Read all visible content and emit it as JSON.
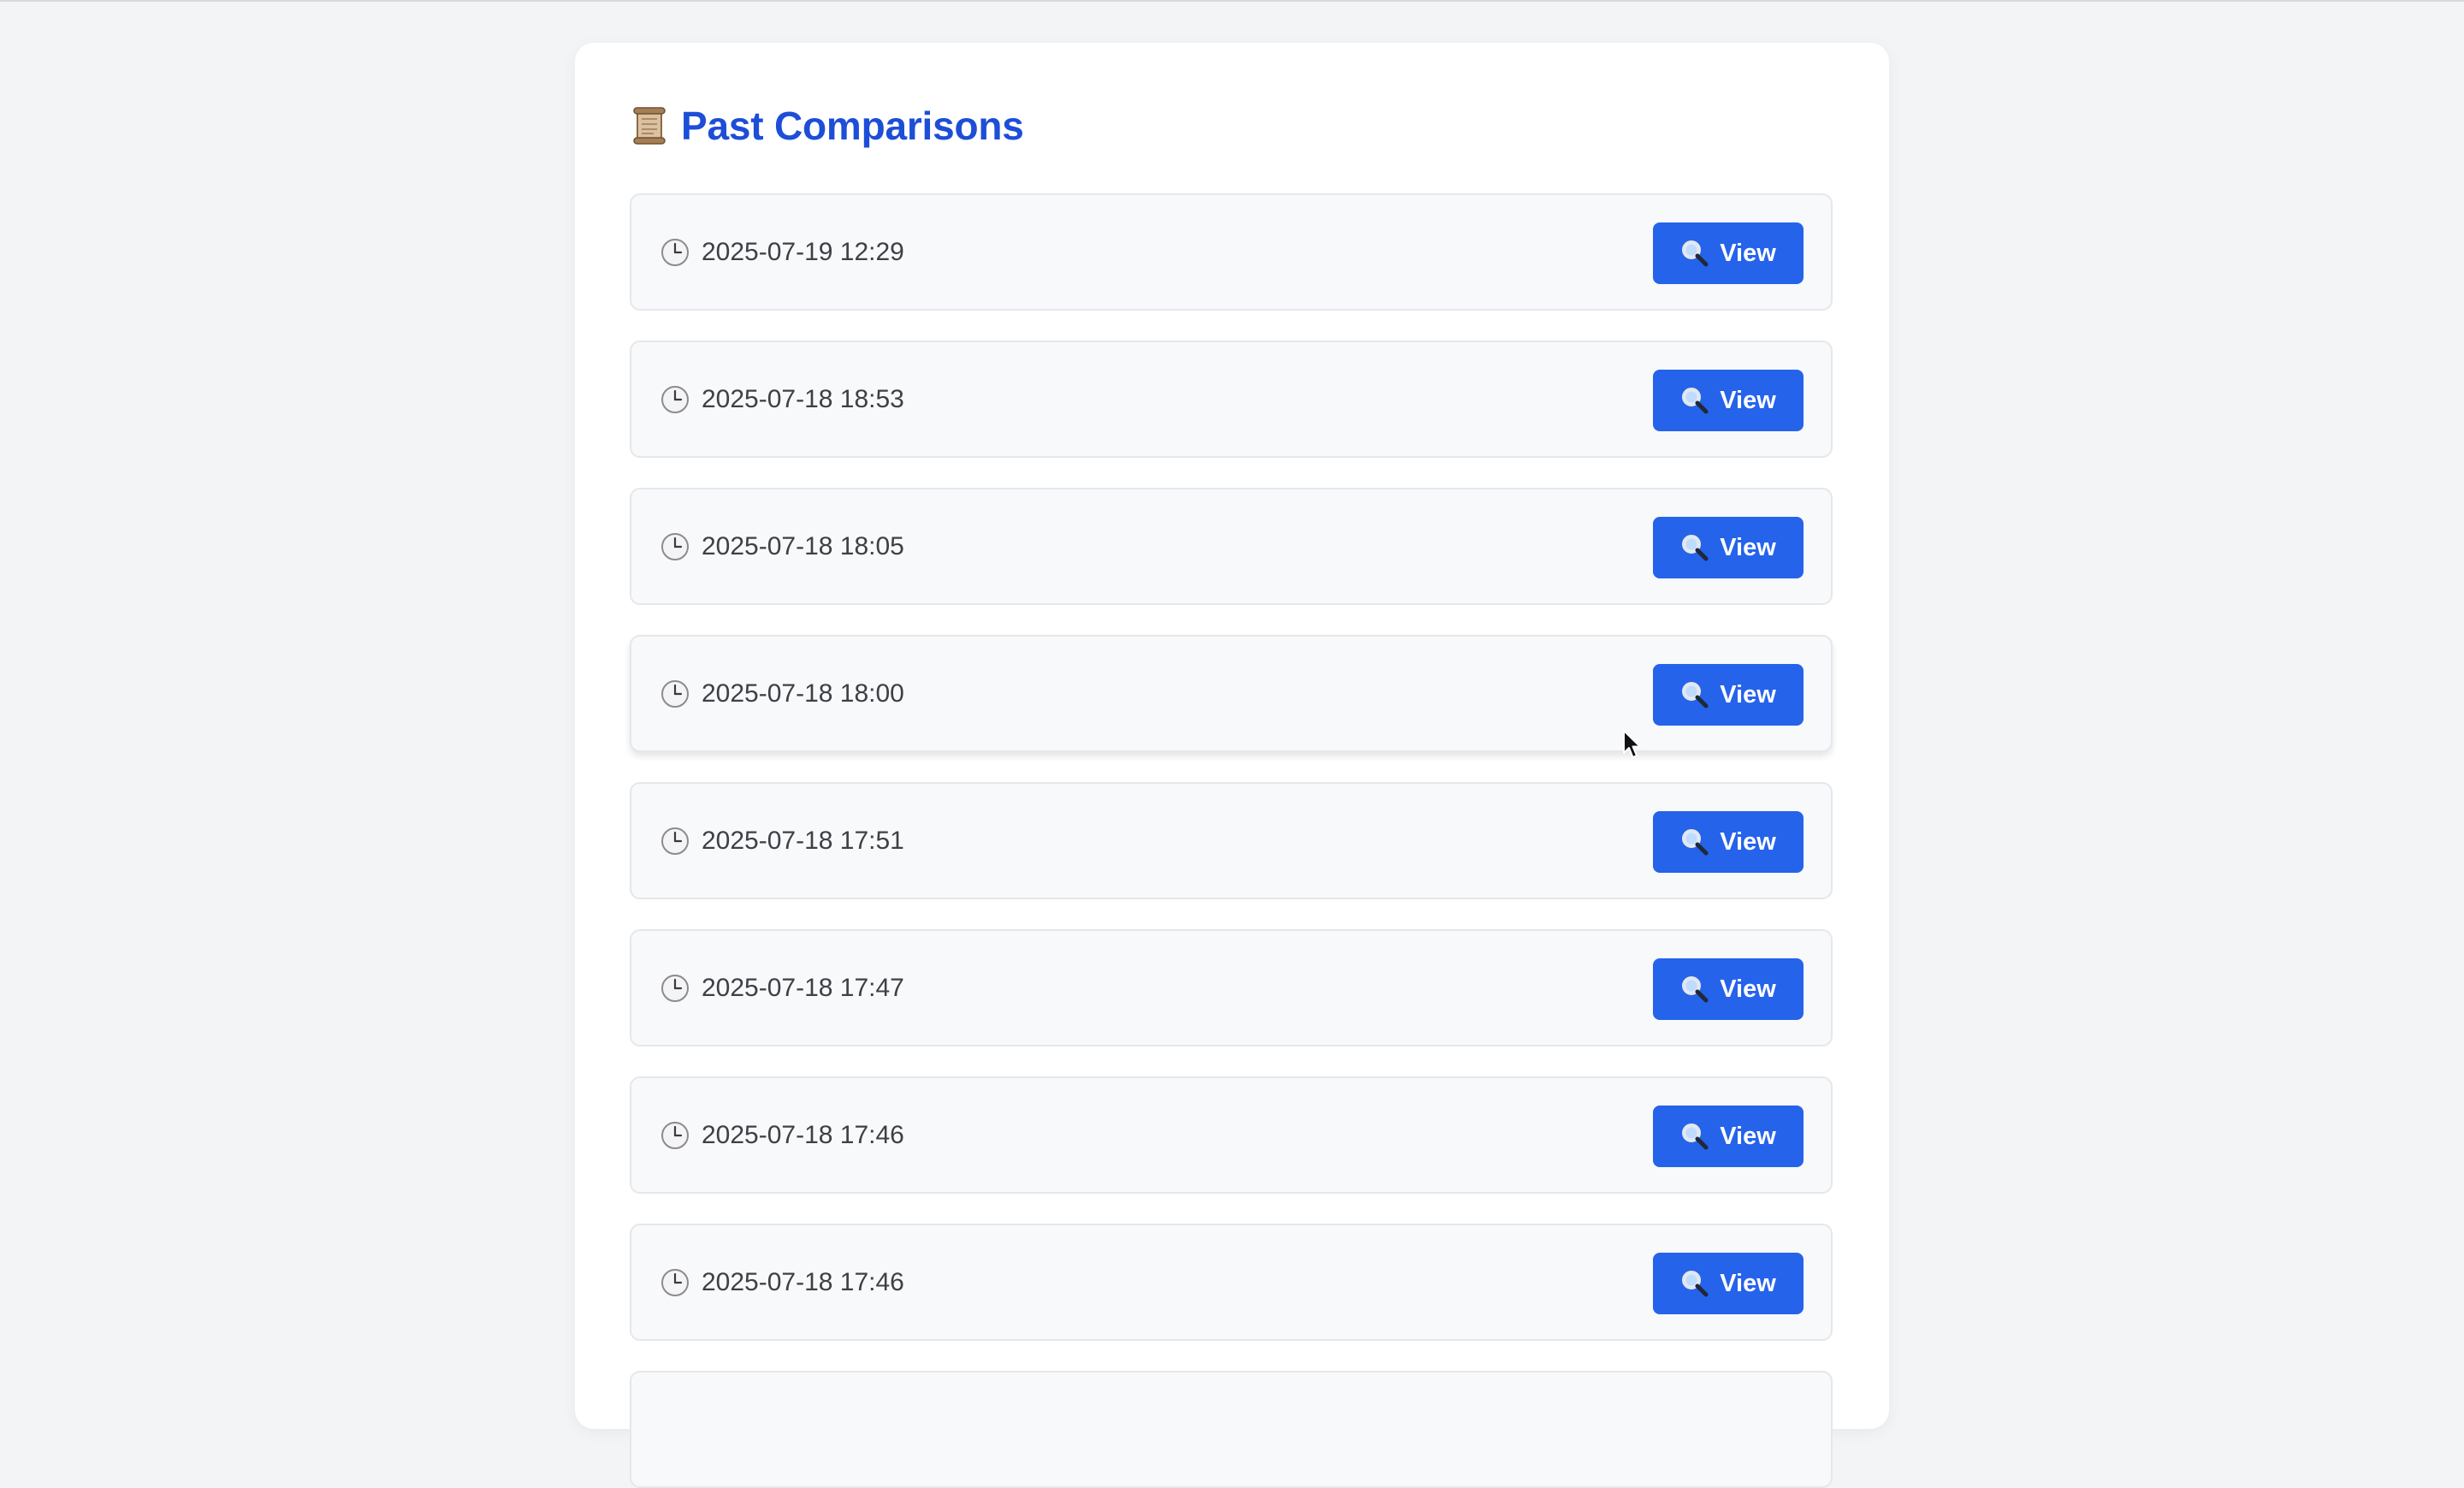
{
  "page": {
    "title": "Past Comparisons",
    "title_icon": "scroll-icon",
    "accent_color": "#1d4ed8",
    "button_color": "#2563eb"
  },
  "comparisons": [
    {
      "timestamp": "2025-07-19 12:29",
      "icon": "clock-icon",
      "view_label": "View",
      "view_icon": "magnifier-icon"
    },
    {
      "timestamp": "2025-07-18 18:53",
      "icon": "clock-icon",
      "view_label": "View",
      "view_icon": "magnifier-icon"
    },
    {
      "timestamp": "2025-07-18 18:05",
      "icon": "clock-icon",
      "view_label": "View",
      "view_icon": "magnifier-icon"
    },
    {
      "timestamp": "2025-07-18 18:00",
      "icon": "clock-icon",
      "view_label": "View",
      "view_icon": "magnifier-icon"
    },
    {
      "timestamp": "2025-07-18 17:51",
      "icon": "clock-icon",
      "view_label": "View",
      "view_icon": "magnifier-icon"
    },
    {
      "timestamp": "2025-07-18 17:47",
      "icon": "clock-icon",
      "view_label": "View",
      "view_icon": "magnifier-icon"
    },
    {
      "timestamp": "2025-07-18 17:46",
      "icon": "clock-icon",
      "view_label": "View",
      "view_icon": "magnifier-icon"
    },
    {
      "timestamp": "2025-07-18 17:46",
      "icon": "clock-icon",
      "view_label": "View",
      "view_icon": "magnifier-icon"
    }
  ]
}
